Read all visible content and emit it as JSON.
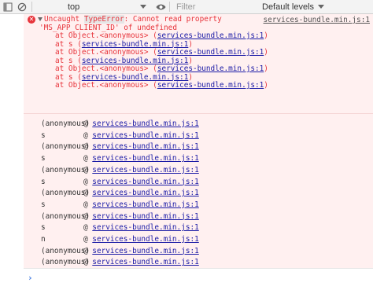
{
  "toolbar": {
    "context_label": "top",
    "filter_placeholder": "Filter",
    "levels_label": "Default levels"
  },
  "error": {
    "prefix": "Uncaught ",
    "error_type": "TypeError",
    "message_rest": ": Cannot read property",
    "message_line2": "'MS_APP_CLIENT_ID' of undefined",
    "source_link": "services-bundle.min.js:1",
    "stack": [
      {
        "at": "at Object.<anonymous> (",
        "link": "services-bundle.min.js:1",
        "close": ")"
      },
      {
        "at": "at s (",
        "link": "services-bundle.min.js:1",
        "close": ")"
      },
      {
        "at": "at Object.<anonymous> (",
        "link": "services-bundle.min.js:1",
        "close": ")"
      },
      {
        "at": "at s (",
        "link": "services-bundle.min.js:1",
        "close": ")"
      },
      {
        "at": "at Object.<anonymous> (",
        "link": "services-bundle.min.js:1",
        "close": ")"
      },
      {
        "at": "at s (",
        "link": "services-bundle.min.js:1",
        "close": ")"
      },
      {
        "at": "at Object.<anonymous> (",
        "link": "services-bundle.min.js:1",
        "close": ")"
      }
    ]
  },
  "trace": [
    {
      "fn": "(anonymous)",
      "at": "@ ",
      "link": "services-bundle.min.js:1"
    },
    {
      "fn": "s",
      "at": "@ ",
      "link": "services-bundle.min.js:1"
    },
    {
      "fn": "(anonymous)",
      "at": "@ ",
      "link": "services-bundle.min.js:1"
    },
    {
      "fn": "s",
      "at": "@ ",
      "link": "services-bundle.min.js:1"
    },
    {
      "fn": "(anonymous)",
      "at": "@ ",
      "link": "services-bundle.min.js:1"
    },
    {
      "fn": "s",
      "at": "@ ",
      "link": "services-bundle.min.js:1"
    },
    {
      "fn": "(anonymous)",
      "at": "@ ",
      "link": "services-bundle.min.js:1"
    },
    {
      "fn": "s",
      "at": "@ ",
      "link": "services-bundle.min.js:1"
    },
    {
      "fn": "(anonymous)",
      "at": "@ ",
      "link": "services-bundle.min.js:1"
    },
    {
      "fn": "s",
      "at": "@ ",
      "link": "services-bundle.min.js:1"
    },
    {
      "fn": "n",
      "at": "@ ",
      "link": "services-bundle.min.js:1"
    },
    {
      "fn": "(anonymous)",
      "at": "@ ",
      "link": "services-bundle.min.js:1"
    },
    {
      "fn": "(anonymous)",
      "at": "@ ",
      "link": "services-bundle.min.js:1"
    }
  ],
  "prompt_symbol": "›",
  "icons": {
    "error": "error-icon",
    "clear": "clear-console-icon",
    "eye": "eye-icon"
  },
  "colors": {
    "error_text": "#e7333a",
    "error_bg": "#fff0f0",
    "link": "#1a1aa6"
  }
}
